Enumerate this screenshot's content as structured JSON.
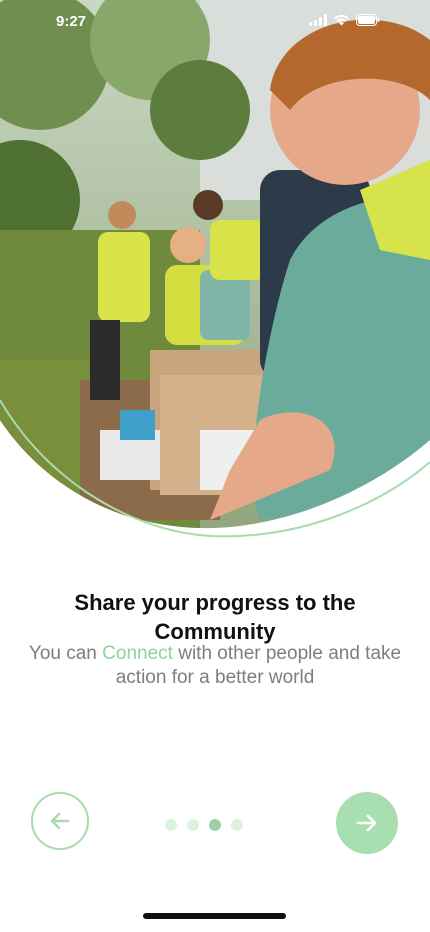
{
  "status_bar": {
    "time": "9:27"
  },
  "onboarding": {
    "title": "Share your progress to the Community",
    "subtitle_before": "You can ",
    "subtitle_highlight": "Connect",
    "subtitle_after": " with other people and take action for a better world",
    "total_steps": 4,
    "current_step": 3
  },
  "colors": {
    "accent": "#a9deb0",
    "highlight_text": "#8fd29a",
    "title": "#111111",
    "subtitle": "#7d7d7d"
  },
  "icons": {
    "prev": "arrow-left-icon",
    "next": "arrow-right-icon"
  }
}
